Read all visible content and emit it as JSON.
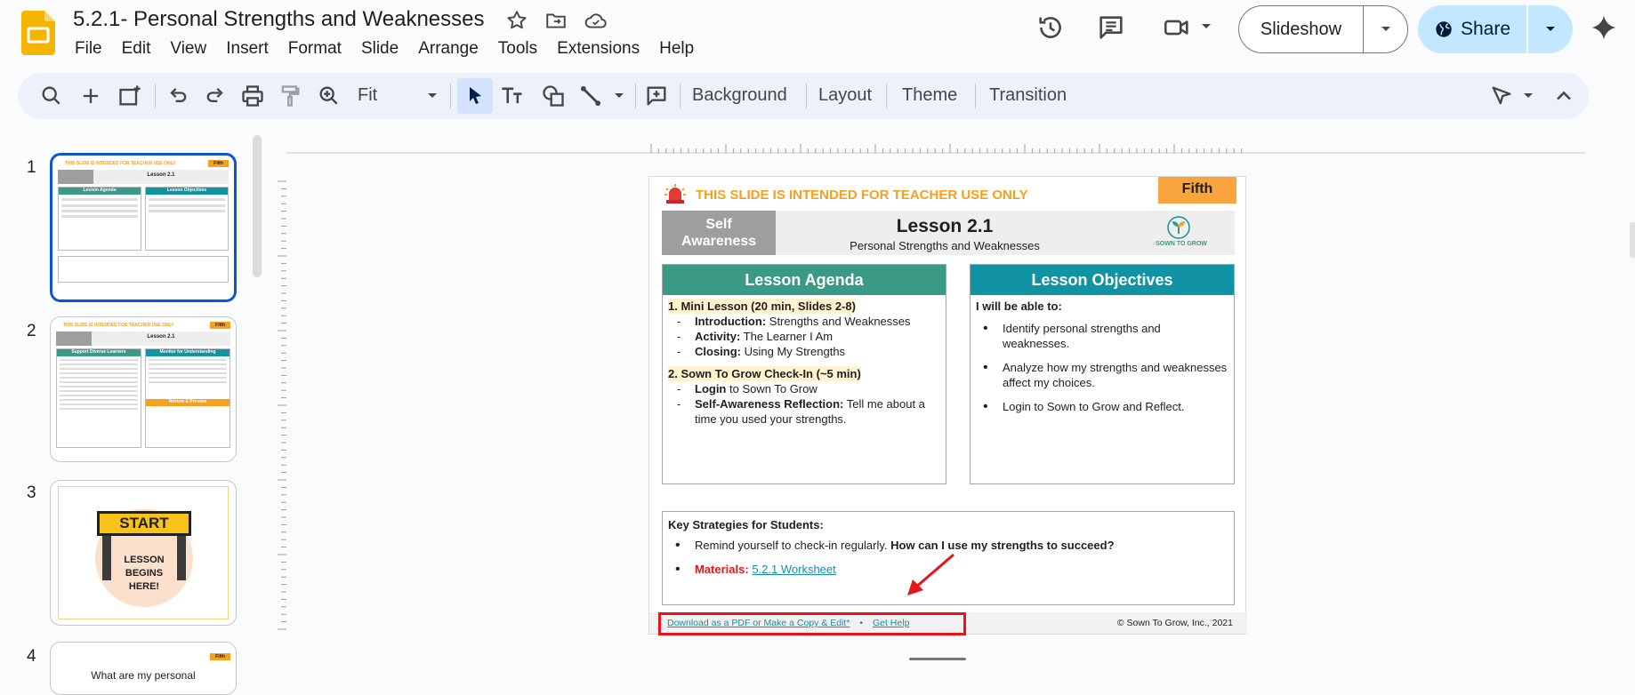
{
  "app": {
    "doc_title": "5.2.1- Personal Strengths and Weaknesses",
    "menu": [
      "File",
      "Edit",
      "View",
      "Insert",
      "Format",
      "Slide",
      "Arrange",
      "Tools",
      "Extensions",
      "Help"
    ],
    "slideshow_label": "Slideshow",
    "share_label": "Share"
  },
  "toolbar": {
    "zoom_value": "Fit",
    "background_label": "Background",
    "layout_label": "Layout",
    "theme_label": "Theme",
    "transition_label": "Transition"
  },
  "filmstrip": {
    "slide_numbers": [
      "1",
      "2",
      "3",
      "4"
    ],
    "thumb1": {
      "banner": "THIS SLIDE IS INTENDED FOR TEACHER USE ONLY",
      "grade": "Fifth",
      "lesson": "Lesson 2.1",
      "agenda": "Lesson Agenda",
      "objectives": "Lesson Objectives"
    },
    "thumb2": {
      "banner": "THIS SLIDE IS INTENDED FOR TEACHER USE ONLY",
      "grade": "Fifth",
      "lesson": "Lesson 2.1",
      "left_head": "Support Diverse Learners",
      "right_head": "Monitor for Understanding",
      "review": "Review & Preview"
    },
    "thumb3": {
      "sign": "START",
      "text": "LESSON BEGINS HERE!"
    },
    "thumb4": {
      "grade": "Fifth",
      "text": "What are my personal"
    }
  },
  "slide": {
    "banner": "THIS SLIDE IS INTENDED FOR TEACHER USE ONLY",
    "grade": "Fifth",
    "topic": "Self Awareness",
    "lesson_title": "Lesson 2.1",
    "lesson_subtitle": "Personal Strengths and Weaknesses",
    "brand": "SOWN TO GROW",
    "agenda": {
      "heading": "Lesson Agenda",
      "mini_lesson": "1. Mini Lesson (20 min, Slides 2-8)",
      "items1": [
        {
          "label": "Introduction:",
          "text": " Strengths and Weaknesses"
        },
        {
          "label": "Activity:",
          "text": " The Learner I Am"
        },
        {
          "label": "Closing:",
          "text": " Using My Strengths"
        }
      ],
      "checkin": "2. Sown To Grow Check-In (~5 min)",
      "items2": [
        {
          "label": "Login",
          "text": " to Sown To Grow"
        },
        {
          "label": "Self-Awareness Reflection:",
          "text": " Tell me about a time you used your strengths."
        }
      ]
    },
    "objectives": {
      "heading": "Lesson Objectives",
      "intro": "I will be able to:",
      "items": [
        "Identify personal strengths and weaknesses.",
        "Analyze how my strengths and weaknesses affect my choices.",
        "Login to Sown to Grow and Reflect."
      ]
    },
    "strategies": {
      "heading": "Key Strategies for Students:",
      "item1_text": "Remind yourself to check-in regularly. ",
      "item1_bold": "How can I use my strengths to succeed?",
      "materials_label": "Materials:",
      "materials_link": "5.2.1 Worksheet"
    },
    "footer": {
      "download_link": "Download as a PDF or Make a Copy & Edit*",
      "bullet": "•",
      "help_link": "Get Help",
      "copyright": "© Sown To Grow, Inc., 2021"
    }
  },
  "colors": {
    "accent_orange": "#f79f1f",
    "agenda_green": "#3a9a86",
    "objectives_teal": "#1193a3",
    "highlight_yellow": "#fff2cc",
    "annotation_red": "#e8141b",
    "active_blue": "#0b57d0"
  }
}
